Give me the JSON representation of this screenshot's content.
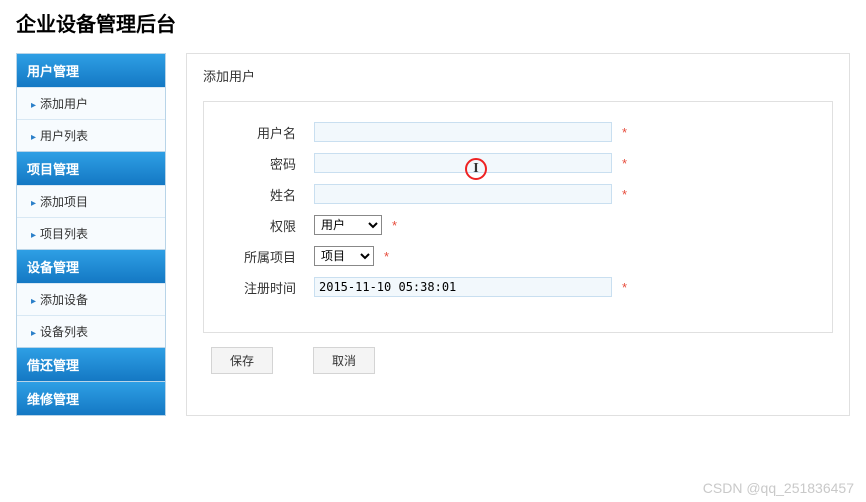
{
  "app_title": "企业设备管理后台",
  "sidebar": {
    "sections": [
      {
        "header": "用户管理",
        "items": [
          "添加用户",
          "用户列表"
        ]
      },
      {
        "header": "项目管理",
        "items": [
          "添加项目",
          "项目列表"
        ]
      },
      {
        "header": "设备管理",
        "items": [
          "添加设备",
          "设备列表"
        ]
      },
      {
        "header": "借还管理",
        "items": []
      },
      {
        "header": "维修管理",
        "items": []
      }
    ]
  },
  "form": {
    "title": "添加用户",
    "labels": {
      "username": "用户名",
      "password": "密码",
      "realname": "姓名",
      "permission": "权限",
      "project": "所属项目",
      "regtime": "注册时间"
    },
    "values": {
      "username": "",
      "password": "",
      "realname": "",
      "permission": "用户",
      "project": "项目",
      "regtime": "2015-11-10 05:38:01"
    },
    "required_mark": "*",
    "buttons": {
      "save": "保存",
      "cancel": "取消"
    }
  },
  "watermark": "CSDN @qq_251836457"
}
